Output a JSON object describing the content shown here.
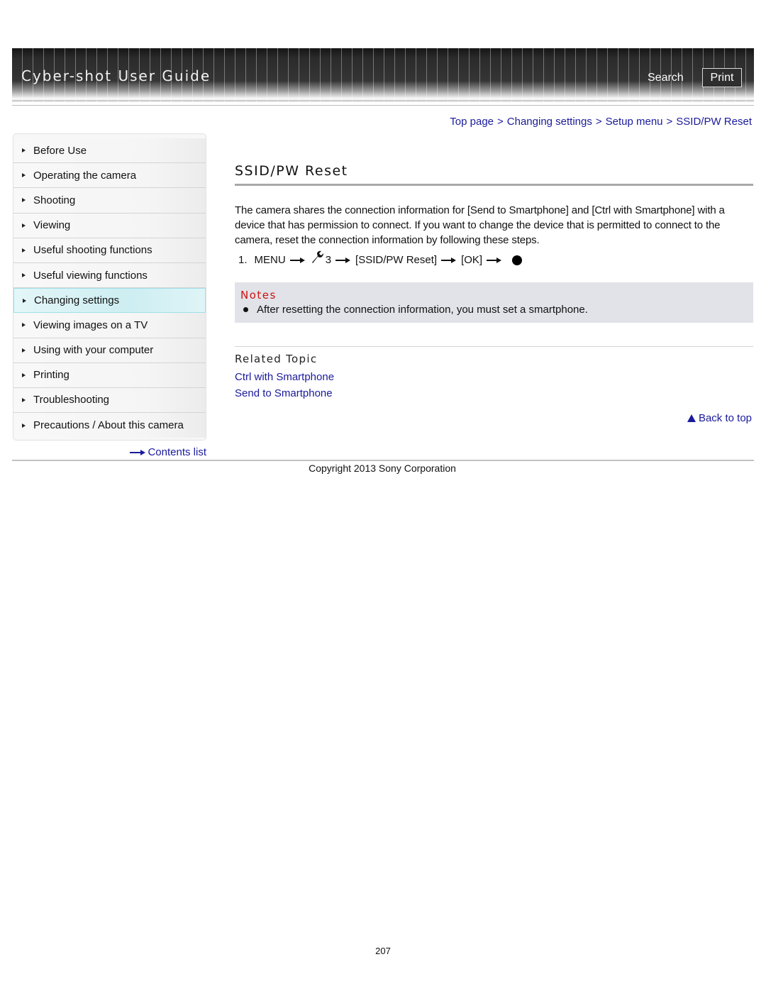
{
  "header": {
    "title": "Cyber-shot User Guide",
    "search_label": "Search",
    "print_label": "Print"
  },
  "breadcrumb": {
    "items": [
      "Top page",
      "Changing settings",
      "Setup menu",
      "SSID/PW Reset"
    ],
    "separator": ">"
  },
  "sidebar": {
    "items": [
      {
        "label": "Before Use",
        "active": false
      },
      {
        "label": "Operating the camera",
        "active": false
      },
      {
        "label": "Shooting",
        "active": false
      },
      {
        "label": "Viewing",
        "active": false
      },
      {
        "label": "Useful shooting functions",
        "active": false
      },
      {
        "label": "Useful viewing functions",
        "active": false
      },
      {
        "label": "Changing settings",
        "active": true
      },
      {
        "label": "Viewing images on a TV",
        "active": false
      },
      {
        "label": "Using with your computer",
        "active": false
      },
      {
        "label": "Printing",
        "active": false
      },
      {
        "label": "Troubleshooting",
        "active": false
      },
      {
        "label": "Precautions / About this camera",
        "active": false
      }
    ],
    "contents_list_label": "Contents list"
  },
  "main": {
    "title": "SSID/PW Reset",
    "intro": "The camera shares the connection information for [Send to Smartphone] and [Ctrl with Smartphone] with a device that has permission to connect. If you want to change the device that is permitted to connect to the camera, reset the connection information by following these steps.",
    "step": {
      "number": "1.",
      "menu": "MENU",
      "setup_tab_number": "3",
      "item": "[SSID/PW Reset]",
      "ok": "[OK]",
      "icons": [
        "arrow-icon",
        "wrench-icon",
        "center-button-icon"
      ]
    },
    "notes": {
      "title": "Notes",
      "items": [
        "After resetting the connection information, you must set a smartphone."
      ]
    },
    "related": {
      "title": "Related Topic",
      "links": [
        "Ctrl with Smartphone",
        "Send to Smartphone"
      ]
    },
    "back_to_top_label": "Back to top"
  },
  "footer": {
    "copyright": "Copyright 2013 Sony Corporation",
    "page_number": "207"
  },
  "colors": {
    "link": "#1a1a9c",
    "notes_title": "#cc1111",
    "notes_bg": "#e1e3e8",
    "active_nav_bg": "#cdeef2"
  }
}
